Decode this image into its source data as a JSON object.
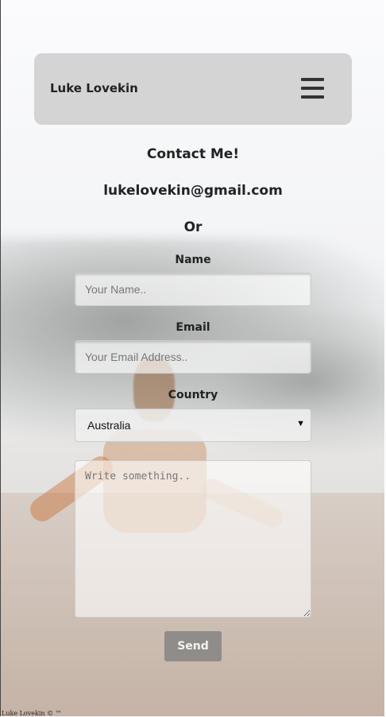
{
  "brand": "Luke Lovekin",
  "heading": "Contact Me!",
  "email": "lukelovekin@gmail.com",
  "or": "Or",
  "form": {
    "name_label": "Name",
    "name_placeholder": "Your Name..",
    "email_label": "Email",
    "email_placeholder": "Your Email Address..",
    "country_label": "Country",
    "country_value": "Australia",
    "message_placeholder": "Write something..",
    "send_label": "Send"
  },
  "footer": "Luke Lovekin © ™",
  "icons": {
    "menu": "hamburger-menu-icon",
    "select_arrow": "caret-down-icon"
  },
  "colors": {
    "navbar": "#d2d2d2",
    "send_button": "#8f8c89"
  }
}
